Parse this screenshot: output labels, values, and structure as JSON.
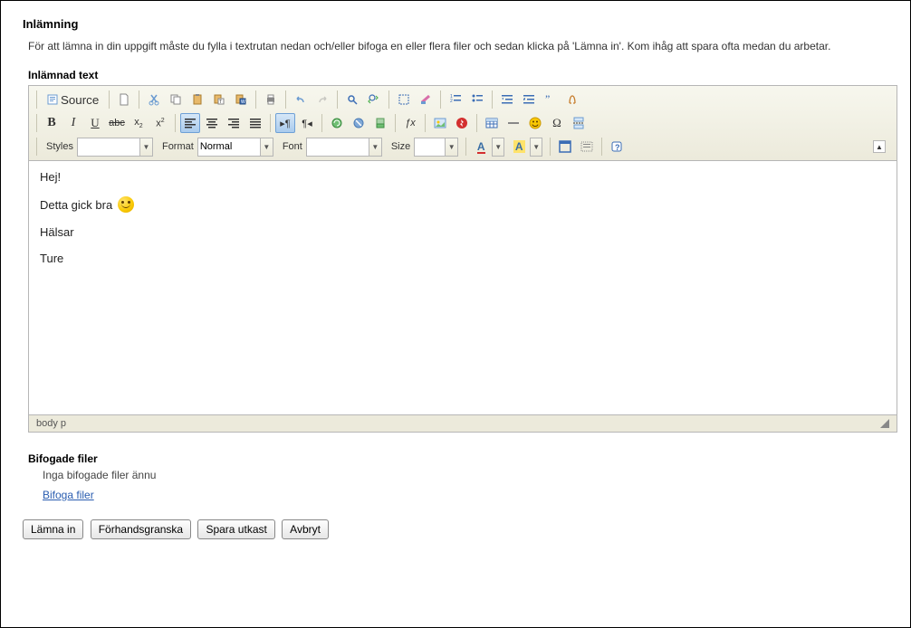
{
  "section_title": "Inlämning",
  "intro_text": "För att lämna in din uppgift måste du fylla i textrutan nedan och/eller bifoga en eller flera filer och sedan klicka på 'Lämna in'. Kom ihåg att spara ofta medan du arbetar.",
  "submitted_text_label": "Inlämnad text",
  "toolbar": {
    "source_label": "Source",
    "styles_label": "Styles",
    "format_label": "Format",
    "format_value": "Normal",
    "font_label": "Font",
    "size_label": "Size"
  },
  "editor_content": {
    "p1": "Hej!",
    "p2": "Detta gick bra ",
    "p3": "Hälsar",
    "p4": "Ture"
  },
  "editor_path": "body p",
  "attached": {
    "heading": "Bifogade filer",
    "none_text": "Inga bifogade filer ännu",
    "attach_link": "Bifoga filer"
  },
  "buttons": {
    "submit": "Lämna in",
    "preview": "Förhandsgranska",
    "save_draft": "Spara utkast",
    "cancel": "Avbryt"
  }
}
